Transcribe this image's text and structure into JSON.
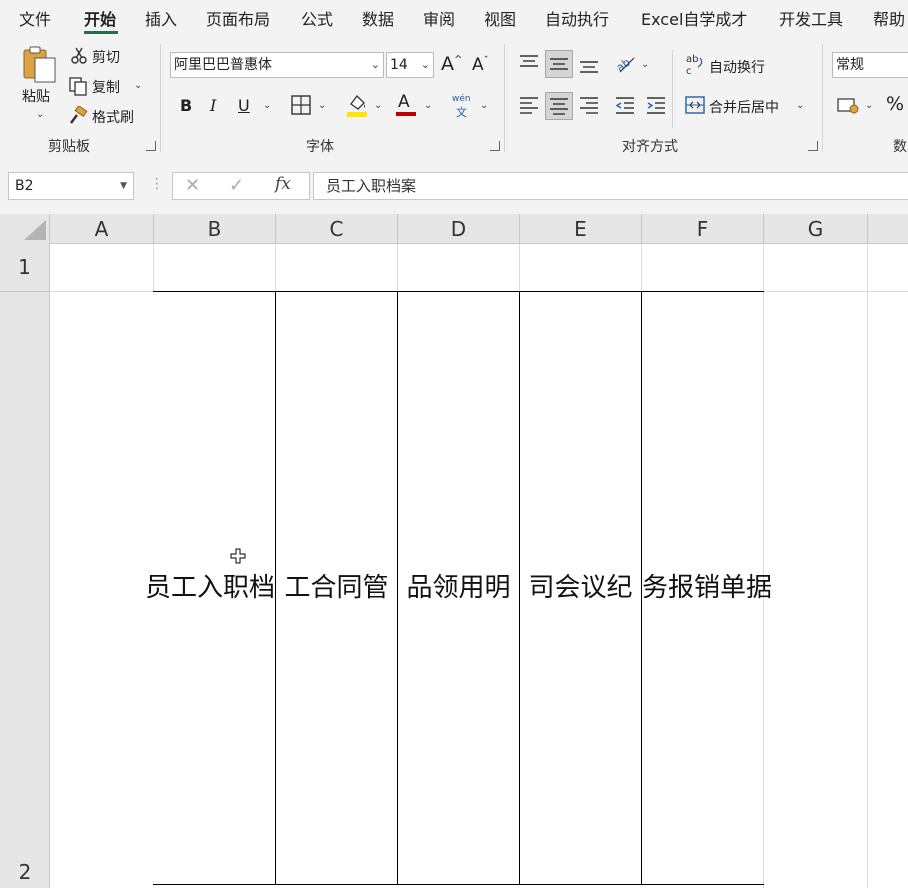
{
  "menu": {
    "tabs": [
      "文件",
      "开始",
      "插入",
      "页面布局",
      "公式",
      "数据",
      "审阅",
      "视图",
      "自动执行",
      "Excel自学成才",
      "开发工具",
      "帮助"
    ],
    "active_index": 1,
    "accent": "#217346"
  },
  "ribbon": {
    "clipboard": {
      "paste": "粘贴",
      "cut": "剪切",
      "copy": "复制",
      "format_painter": "格式刷",
      "group_label": "剪贴板"
    },
    "font": {
      "font_name": "阿里巴巴普惠体",
      "font_size": "14",
      "bold": "B",
      "italic": "I",
      "underline": "U",
      "font_color_glyph": "A",
      "phonetic_top": "wén",
      "phonetic_bottom": "文",
      "group_label": "字体",
      "fill_color": "#ffe600",
      "font_color": "#c00000"
    },
    "alignment": {
      "wrap_text": "自动换行",
      "merge_center": "合并后居中",
      "group_label": "对齐方式"
    },
    "number": {
      "format": "常规",
      "percent": "%",
      "group_label_partial": "数"
    }
  },
  "formula_bar": {
    "name_box": "B2",
    "fx": "fx",
    "content": "员工入职档案"
  },
  "sheet": {
    "columns": [
      "A",
      "B",
      "C",
      "D",
      "E",
      "F",
      "G"
    ],
    "rows": [
      "1",
      "2"
    ],
    "cells": {
      "B2": "员工入职档",
      "C2": "工合同管",
      "D2": "品领用明",
      "E2": "司会议纪",
      "F2": "务报销单据"
    }
  }
}
